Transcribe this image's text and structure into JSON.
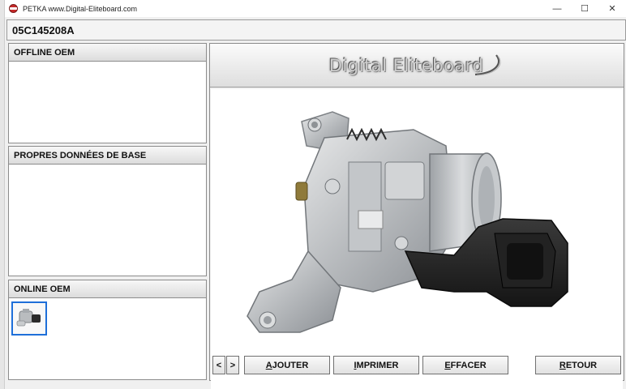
{
  "window": {
    "title": "PETKA www.Digital-Eliteboard.com",
    "controls": {
      "minimize": "—",
      "maximize": "☐",
      "close": "✕"
    }
  },
  "header": {
    "part_number": "05C145208A"
  },
  "panels": {
    "offline": {
      "title": "OFFLINE OEM"
    },
    "base_data": {
      "title": "PROPRES DONNÉES DE BASE"
    },
    "online": {
      "title": "ONLINE OEM"
    }
  },
  "logo": {
    "text": "Digital Eliteboard"
  },
  "buttons": {
    "prev": "<",
    "next": ">",
    "add": {
      "first": "A",
      "rest": "JOUTER"
    },
    "print": {
      "first": "I",
      "rest": "MPRIMER"
    },
    "erase": {
      "first": "E",
      "rest": "FFACER"
    },
    "back": {
      "first": "R",
      "rest": "ETOUR"
    }
  },
  "colors": {
    "thumb_selected_border": "#1e6fd9"
  }
}
